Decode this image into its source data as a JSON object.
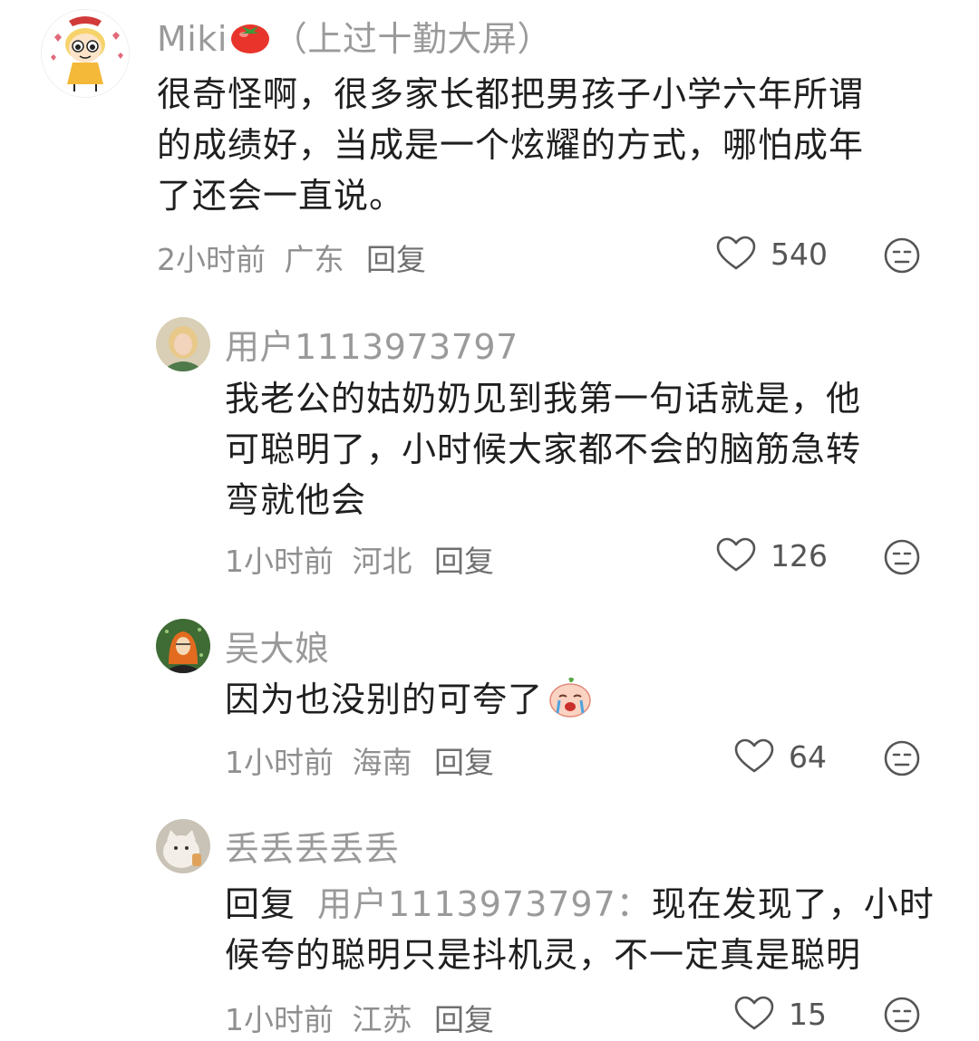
{
  "comments": [
    {
      "name": "Miki",
      "name_suffix": "（上过十勤大屏）",
      "text_lines": [
        "很奇怪啊，很多家长都把男孩子小学六年所谓",
        "的成绩好，当成是一个炫耀的方式，哪怕成年",
        "了还会一直说。"
      ],
      "time": "2小时前",
      "region": "广东",
      "reply_label": "回复",
      "likes": "540"
    },
    {
      "name": "用户1113973797",
      "text_lines": [
        "我老公的姑奶奶见到我第一句话就是，他",
        "可聪明了，小时候大家都不会的脑筋急转",
        "弯就他会"
      ],
      "time": "1小时前",
      "region": "河北",
      "reply_label": "回复",
      "likes": "126"
    },
    {
      "name": "吴大娘",
      "text_lines": [
        "因为也没别的可夸了"
      ],
      "time": "1小时前",
      "region": "海南",
      "reply_label": "回复",
      "likes": "64"
    },
    {
      "name": "丢丢丢丢丢",
      "reply_prefix": "回复",
      "reply_target": "用户1113973797：",
      "text_lines": [
        "现在发现了，小时",
        "候夸的聪明只是抖机灵，不一定真是聪明"
      ],
      "time": "1小时前",
      "region": "江苏",
      "reply_label": "回复",
      "likes": "15"
    }
  ],
  "icons": {
    "like": "heart-outline-icon",
    "dislike": "meh-face-icon",
    "name_emoji": "tomato-icon",
    "text_emoji": "crying-peach-sticker"
  },
  "colors": {
    "text": "#1f1f1f",
    "meta": "#8f8f8f",
    "name": "#9a9a9a",
    "icon": "#555555"
  }
}
